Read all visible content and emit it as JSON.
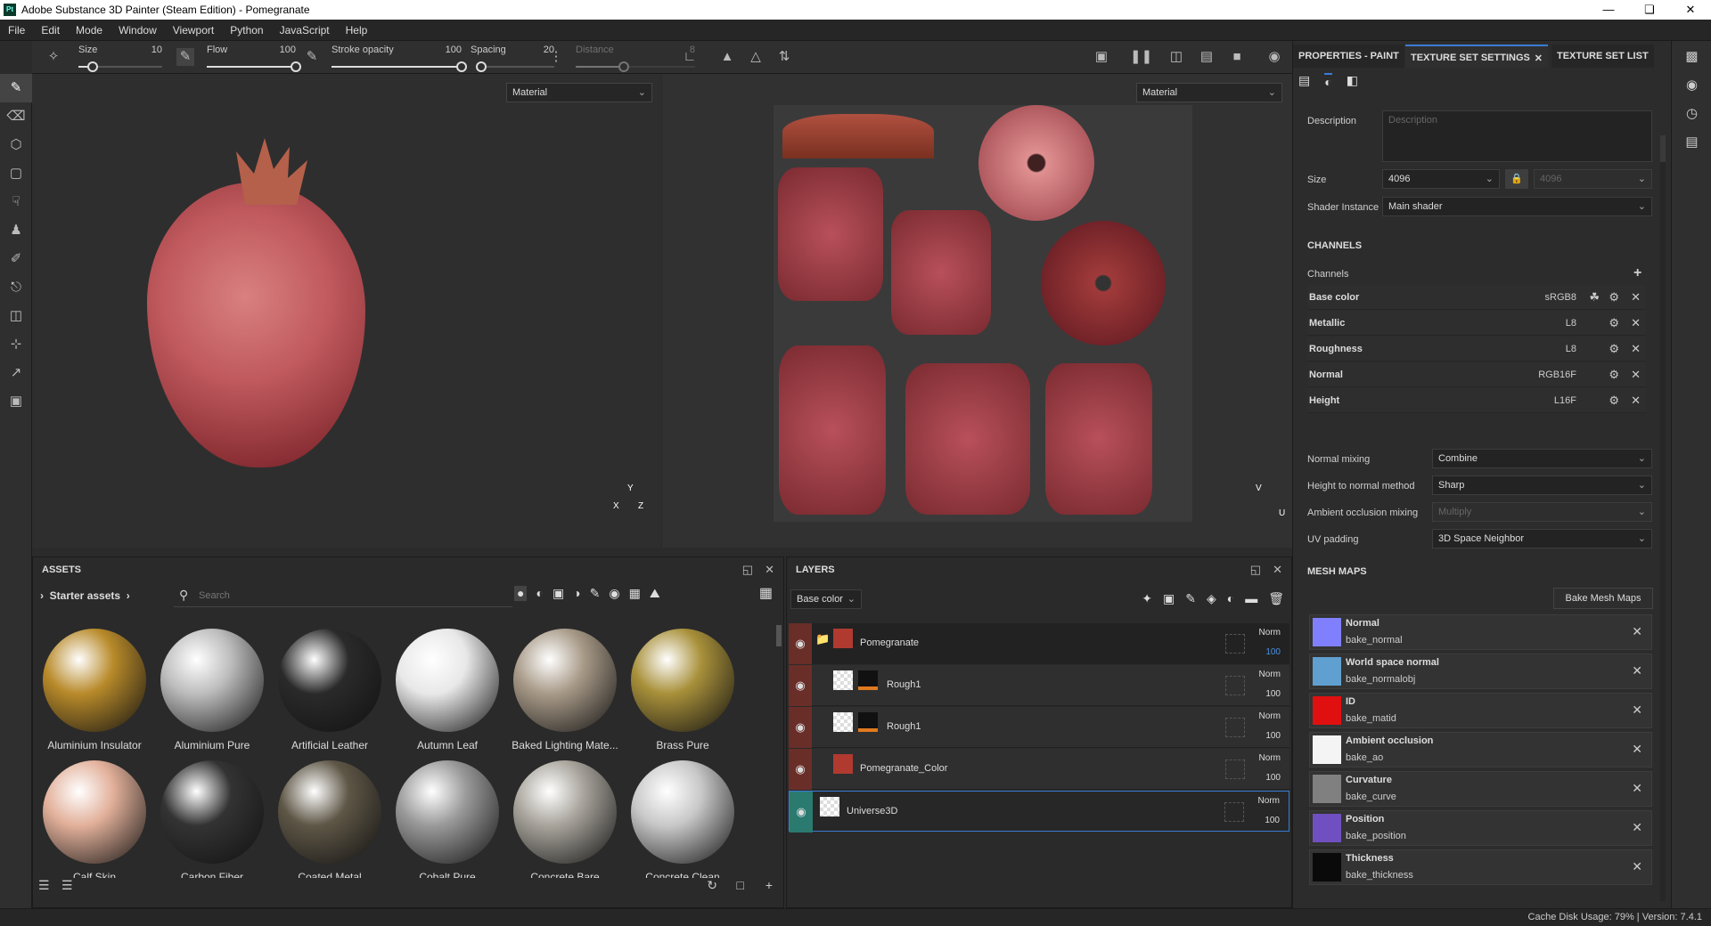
{
  "window": {
    "title": "Adobe Substance 3D Painter (Steam Edition) - Pomegranate",
    "logo": "Pt"
  },
  "menu": [
    "File",
    "Edit",
    "Mode",
    "Window",
    "Viewport",
    "Python",
    "JavaScript",
    "Help"
  ],
  "toolbar": {
    "size": {
      "label": "Size",
      "value": "10",
      "fraction": 0.17
    },
    "flow": {
      "label": "Flow",
      "value": "100",
      "fraction": 1.0
    },
    "stroke_opacity": {
      "label": "Stroke opacity",
      "value": "100",
      "fraction": 1.0
    },
    "spacing": {
      "label": "Spacing",
      "value": "20",
      "fraction": 0.05
    },
    "distance": {
      "label": "Distance",
      "value": "8",
      "fraction": 0.4
    }
  },
  "viewport": {
    "left_mode": "Material",
    "right_mode": "Material",
    "axis_3d": {
      "y": "Y",
      "x": "X",
      "z": "Z"
    },
    "axis_uv": {
      "v": "V",
      "u": "U"
    }
  },
  "assets": {
    "title": "ASSETS",
    "breadcrumb": "Starter assets",
    "search_placeholder": "Search",
    "items": [
      {
        "name": "Aluminium Insulator",
        "color": "#b88a2a"
      },
      {
        "name": "Aluminium Pure",
        "color": "#bdbdbd"
      },
      {
        "name": "Artificial Leather",
        "color": "#2a2a2a"
      },
      {
        "name": "Autumn Leaf",
        "color": "#e8e8e8"
      },
      {
        "name": "Baked Lighting Mate...",
        "color": "#a89a88"
      },
      {
        "name": "Brass Pure",
        "color": "#a8903a"
      },
      {
        "name": "Calf Skin",
        "color": "#e2b09a"
      },
      {
        "name": "Carbon Fiber",
        "color": "#333333"
      },
      {
        "name": "Coated Metal",
        "color": "#5e5646"
      },
      {
        "name": "Cobalt Pure",
        "color": "#9a9a9a"
      },
      {
        "name": "Concrete Bare",
        "color": "#a8a49c"
      },
      {
        "name": "Concrete Clean",
        "color": "#c8c8c8"
      }
    ]
  },
  "layers": {
    "title": "LAYERS",
    "channel": "Base color",
    "items": [
      {
        "name": "Pomegranate",
        "blend": "Norm",
        "opacity": "100",
        "folder": true,
        "selected_opacity": true
      },
      {
        "name": "Rough1",
        "blend": "Norm",
        "opacity": "100"
      },
      {
        "name": "Rough1",
        "blend": "Norm",
        "opacity": "100"
      },
      {
        "name": "Pomegranate_Color",
        "blend": "Norm",
        "opacity": "100"
      },
      {
        "name": "Universe3D",
        "blend": "Norm",
        "opacity": "100",
        "selected": true
      }
    ]
  },
  "right": {
    "tabs": [
      "PROPERTIES - PAINT",
      "TEXTURE SET SETTINGS",
      "TEXTURE SET LIST"
    ],
    "description_label": "Description",
    "description_placeholder": "Description",
    "size_label": "Size",
    "size_value": "4096",
    "size_value2": "4096",
    "shader_label": "Shader Instance",
    "shader_value": "Main shader",
    "channels_header": "CHANNELS",
    "channels_label": "Channels",
    "channels": [
      {
        "name": "Base color",
        "format": "sRGB8"
      },
      {
        "name": "Metallic",
        "format": "L8"
      },
      {
        "name": "Roughness",
        "format": "L8"
      },
      {
        "name": "Normal",
        "format": "RGB16F"
      },
      {
        "name": "Height",
        "format": "L16F"
      }
    ],
    "settings": [
      {
        "label": "Normal mixing",
        "value": "Combine"
      },
      {
        "label": "Height to normal method",
        "value": "Sharp"
      },
      {
        "label": "Ambient occlusion mixing",
        "value": "Multiply",
        "disabled": true
      },
      {
        "label": "UV padding",
        "value": "3D Space Neighbor"
      }
    ],
    "mesh_maps_header": "MESH MAPS",
    "bake_button": "Bake Mesh Maps",
    "mesh_maps": [
      {
        "name": "Normal",
        "slot": "bake_normal",
        "color": "#8080ff"
      },
      {
        "name": "World space normal",
        "slot": "bake_normalobj",
        "color": "#60a0d0"
      },
      {
        "name": "ID",
        "slot": "bake_matid",
        "color": "#e01010"
      },
      {
        "name": "Ambient occlusion",
        "slot": "bake_ao",
        "color": "#f4f4f4"
      },
      {
        "name": "Curvature",
        "slot": "bake_curve",
        "color": "#808080"
      },
      {
        "name": "Position",
        "slot": "bake_position",
        "color": "#7050c0"
      },
      {
        "name": "Thickness",
        "slot": "bake_thickness",
        "color": "#0a0a0a"
      }
    ]
  },
  "status": {
    "cache": "Cache Disk Usage:  79% | Version: 7.4.1"
  }
}
